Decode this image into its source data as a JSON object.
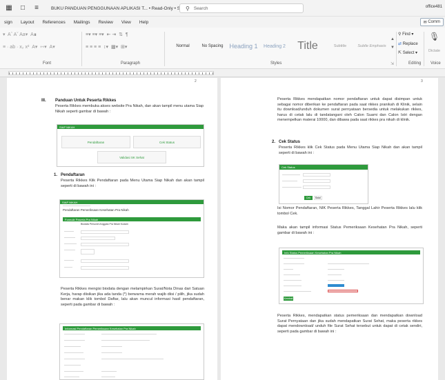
{
  "titlebar": {
    "doc_title": "BUKU PANDUAN PENGGUNAAN APLIKASI T... • Read-Only • Saved ∨",
    "search_placeholder": "Search",
    "user": "office481"
  },
  "menu": [
    "sign",
    "Layout",
    "References",
    "Mailings",
    "Review",
    "View",
    "Help"
  ],
  "comments_label": "Comm",
  "ribbon": {
    "font_group": "Font",
    "paragraph_group": "Paragraph",
    "styles_group": "Styles",
    "editing_group": "Editing",
    "voice_group": "Voice",
    "styles": [
      "Normal",
      "No Spacing",
      "Heading 1",
      "Heading 2",
      "Title",
      "Subtitle",
      "Subtle Emphasis"
    ],
    "find": "Find",
    "replace": "Replace",
    "select": "Select",
    "dictate": "Dictate"
  },
  "pages": {
    "left_number": "2",
    "right_number": "3"
  },
  "left": {
    "sec3_num": "III.",
    "sec3_title": "Panduan Untuk Peserta Rikkes",
    "sec3_text": "Peserta Rikkes membuka akses website Pra Nikah, dan akan tampil menu utama Siap Nikah seperti gambar di bawah :",
    "menu_shot": {
      "bar": "SIAP NIKAH",
      "pendaftaran": "Pendaftaran",
      "cek_status": "Cek Status",
      "validasi": "Validasi SK Sehat"
    },
    "item1_num": "1.",
    "item1_title": "Pendaftaran",
    "item1_text": "Peserta Rikkes Klik Pendaftaran pada Menu Utama Siap Nikah dan akan tampil seperti di bawah ini :",
    "form_shot": {
      "bar": "SIAP NIKAH",
      "title": "Pendaftaran Pemeriksaan Kesehatan Pra Nikah",
      "sub_bar": "Formulir Peserta Pra Nikah",
      "subtitle": "Biodata Personel Anggota Pra Nikah Kodam"
    },
    "item1_text2": "Peserta Rikkes mengisi biodata dengan melampirkan Surat/Nota Dinas dari Satuan Kerja, harap diisikan jika ada tanda (*) berwarna merah wajib diisi / pilih, jika sudah benar makan klik tombol Daftar, lalu akan muncul informasi hasil pendaftaran, seperti pada gambar di bawah :",
    "info_shot": {
      "bar": "Informasi Pendaftaran Pemeriksaan Kesehatan Pra Nikah"
    }
  },
  "right": {
    "p1": "Peserta Rikkes mendapatkan nomor pendaftaran untuk dapat disimpan untuk sebagai nomor diberikan ke pendaftaran pada saat rikkes pranikah di Klinik, selain itu download/unduh dokumen surat pernyataan bersedia untuk melakukan rikkes, harus di cetak lalu di tandatangani oleh Calon Suami dan Calon Istri dengan menempelkan materai 10000, dan dibawa pada saat rikkes pra nikah di klinik.",
    "item2_num": "2.",
    "item2_title": "Cek Status",
    "item2_text": "Peserta Rikkes klik Cek Status pada Menu Utama Siap Nikah dan akan tampil seperti di bawah ini :",
    "cek_shot": {
      "bar": "Cek Status",
      "btn_cek": "Cek",
      "btn_batal": "Batal"
    },
    "p2": "Isi Nomor Pendaftaran, NIK Peserta Rikkes, Tanggal Lahir Peserta Rikkes lalu klik tombol Cek.",
    "p3": "Maka akan tampil informasi Status Pemeriksaan Kesehatan Pra Nikah, seperti gambar di bawah ini :",
    "status_shot": {
      "bar": "Info Status Pemeriksaan Kesehatan Pra Nikah",
      "btn": "Kembali"
    },
    "p4": "Peserta Rikkes, mendapatkan status pemeriksaan dan mendapatkan download Surat Pernyataan dan jika sudah mendapatkan Surat Sehat, maka peserta rikkes dapat mendownload/ unduh file Surat Sehat tersebut untuk dapat di cetak sendiri, seperti pada gambar di bawah ini :"
  }
}
